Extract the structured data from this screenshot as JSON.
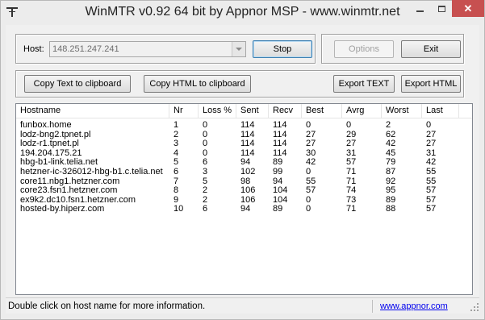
{
  "window": {
    "title": "WinMTR v0.92 64 bit by Appnor MSP - www.winmtr.net",
    "close_glyph": "✕"
  },
  "host": {
    "label": "Host:",
    "value": "148.251.247.241"
  },
  "buttons": {
    "stop": "Stop",
    "options": "Options",
    "exit": "Exit",
    "copy_text": "Copy Text to clipboard",
    "copy_html": "Copy HTML to clipboard",
    "export_text": "Export TEXT",
    "export_html": "Export HTML"
  },
  "table": {
    "columns": [
      "Hostname",
      "Nr",
      "Loss %",
      "Sent",
      "Recv",
      "Best",
      "Avrg",
      "Worst",
      "Last"
    ],
    "rows": [
      [
        "funbox.home",
        "1",
        "0",
        "114",
        "114",
        "0",
        "0",
        "2",
        "0"
      ],
      [
        "lodz-bng2.tpnet.pl",
        "2",
        "0",
        "114",
        "114",
        "27",
        "29",
        "62",
        "27"
      ],
      [
        "lodz-r1.tpnet.pl",
        "3",
        "0",
        "114",
        "114",
        "27",
        "27",
        "42",
        "27"
      ],
      [
        "194.204.175.21",
        "4",
        "0",
        "114",
        "114",
        "30",
        "31",
        "45",
        "31"
      ],
      [
        "hbg-b1-link.telia.net",
        "5",
        "6",
        "94",
        "89",
        "42",
        "57",
        "79",
        "42"
      ],
      [
        "hetzner-ic-326012-hbg-b1.c.telia.net",
        "6",
        "3",
        "102",
        "99",
        "0",
        "71",
        "87",
        "55"
      ],
      [
        "core11.nbg1.hetzner.com",
        "7",
        "5",
        "98",
        "94",
        "55",
        "71",
        "92",
        "55"
      ],
      [
        "core23.fsn1.hetzner.com",
        "8",
        "2",
        "106",
        "104",
        "57",
        "74",
        "95",
        "57"
      ],
      [
        "ex9k2.dc10.fsn1.hetzner.com",
        "9",
        "2",
        "106",
        "104",
        "0",
        "73",
        "89",
        "57"
      ],
      [
        "hosted-by.hiperz.com",
        "10",
        "6",
        "94",
        "89",
        "0",
        "71",
        "88",
        "57"
      ]
    ]
  },
  "status": {
    "message": "Double click on host name for more information.",
    "link": "www.appnor.com"
  },
  "colors": {
    "close_button": "#c75050",
    "link": "#0000ee"
  }
}
